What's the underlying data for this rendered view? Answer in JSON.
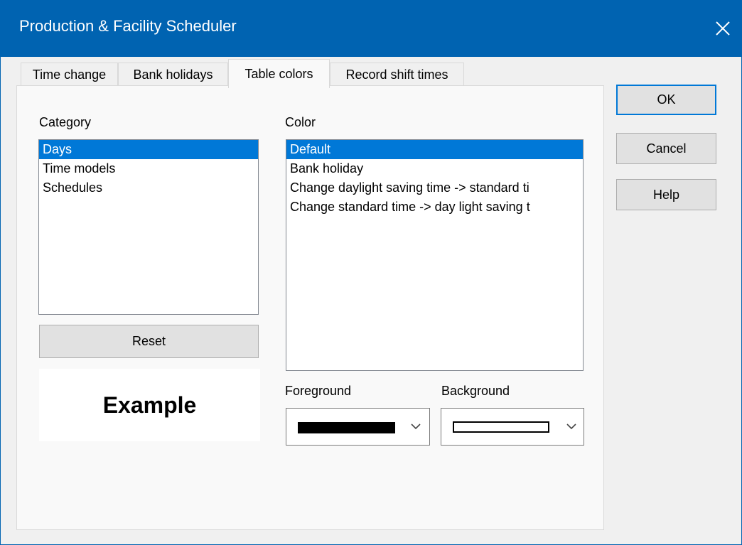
{
  "window": {
    "title": "Production & Facility Scheduler",
    "close_icon": "close-icon"
  },
  "tabs": [
    {
      "label": "Time change"
    },
    {
      "label": "Bank holidays"
    },
    {
      "label": "Table colors",
      "active": true
    },
    {
      "label": "Record shift times"
    }
  ],
  "category": {
    "label": "Category",
    "items": [
      "Days",
      "Time models",
      "Schedules"
    ],
    "selected": "Days"
  },
  "color": {
    "label": "Color",
    "items": [
      "Default",
      "Bank holiday",
      "Change daylight saving time -> standard ti",
      "Change standard time -> day light saving t"
    ],
    "selected": "Default"
  },
  "reset_button": {
    "label": "Reset"
  },
  "example": {
    "text": "Example"
  },
  "foreground": {
    "label": "Foreground",
    "swatch_color": "#000000"
  },
  "background": {
    "label": "Background",
    "swatch_color": "#ffffff"
  },
  "buttons": {
    "ok": "OK",
    "cancel": "Cancel",
    "help": "Help"
  },
  "colors": {
    "titlebar": "#0063b1",
    "selection": "#0078d7"
  }
}
